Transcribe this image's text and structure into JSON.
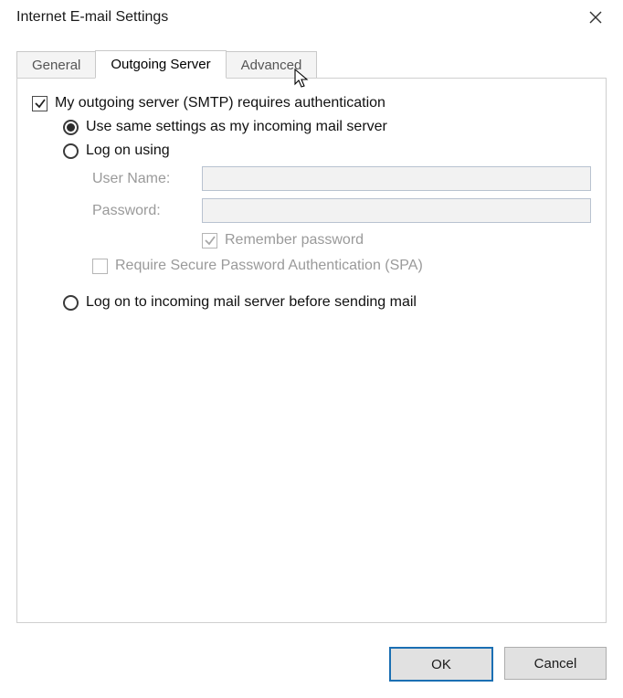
{
  "window": {
    "title": "Internet E-mail Settings"
  },
  "tabs": [
    {
      "label": "General",
      "active": false
    },
    {
      "label": "Outgoing Server",
      "active": true
    },
    {
      "label": "Advanced",
      "active": false
    }
  ],
  "outgoing": {
    "requires_auth_label": "My outgoing server (SMTP) requires authentication",
    "requires_auth_checked": true,
    "opt_same_settings": "Use same settings as my incoming mail server",
    "opt_log_on_using": "Log on using",
    "user_name_label": "User Name:",
    "user_name_value": "",
    "password_label": "Password:",
    "password_value": "",
    "remember_password_label": "Remember password",
    "remember_password_checked": true,
    "require_spa_label": "Require Secure Password Authentication (SPA)",
    "require_spa_checked": false,
    "opt_log_on_incoming": "Log on to incoming mail server before sending mail",
    "selected_option": "same_settings"
  },
  "buttons": {
    "ok": "OK",
    "cancel": "Cancel"
  }
}
